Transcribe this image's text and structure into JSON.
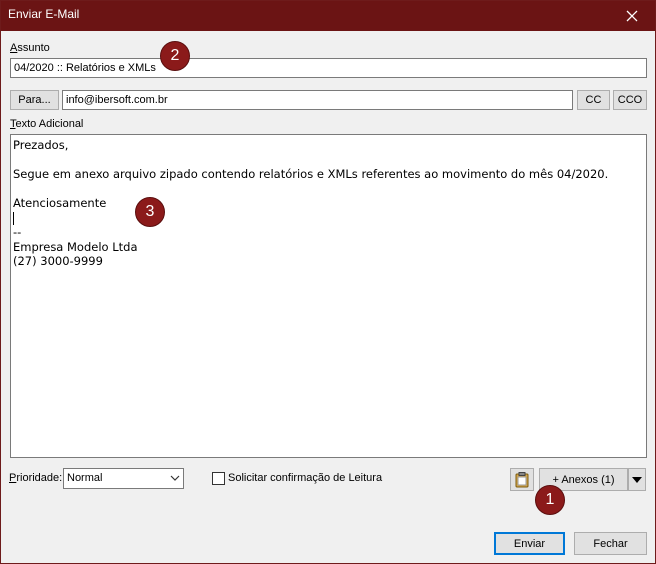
{
  "window": {
    "title": "Enviar E-Mail"
  },
  "subject": {
    "label_ul": "A",
    "label_rest": "ssunto",
    "value": "04/2020 :: Relatórios e XMLs"
  },
  "to": {
    "button_label": "Para...",
    "value": "info@ibersoft.com.br",
    "cc_label": "CC",
    "cco_label": "CCO"
  },
  "body_text": {
    "label_ul": "T",
    "label_rest": "exto Adicional",
    "lines": [
      "Prezados,",
      "",
      "Segue em anexo arquivo zipado contendo relatórios e XMLs referentes ao movimento do mês 04/2020.",
      "",
      "Atenciosamente",
      "",
      "--",
      "Empresa Modelo Ltda",
      "(27) 3000-9999"
    ]
  },
  "priority": {
    "label_ul": "P",
    "label_rest": "rioridade:",
    "value": "Normal"
  },
  "read_receipt": {
    "label": "Solicitar confirmação de Leitura",
    "checked": false
  },
  "attachments": {
    "button_label": "+ Anexos (1)"
  },
  "actions": {
    "send_label": "Enviar",
    "close_label": "Fechar"
  },
  "badges": [
    "1",
    "2",
    "3"
  ],
  "colors": {
    "titlebar": "#6b1414",
    "badge": "#8b1a1a",
    "default_button_border": "#0078d7"
  }
}
